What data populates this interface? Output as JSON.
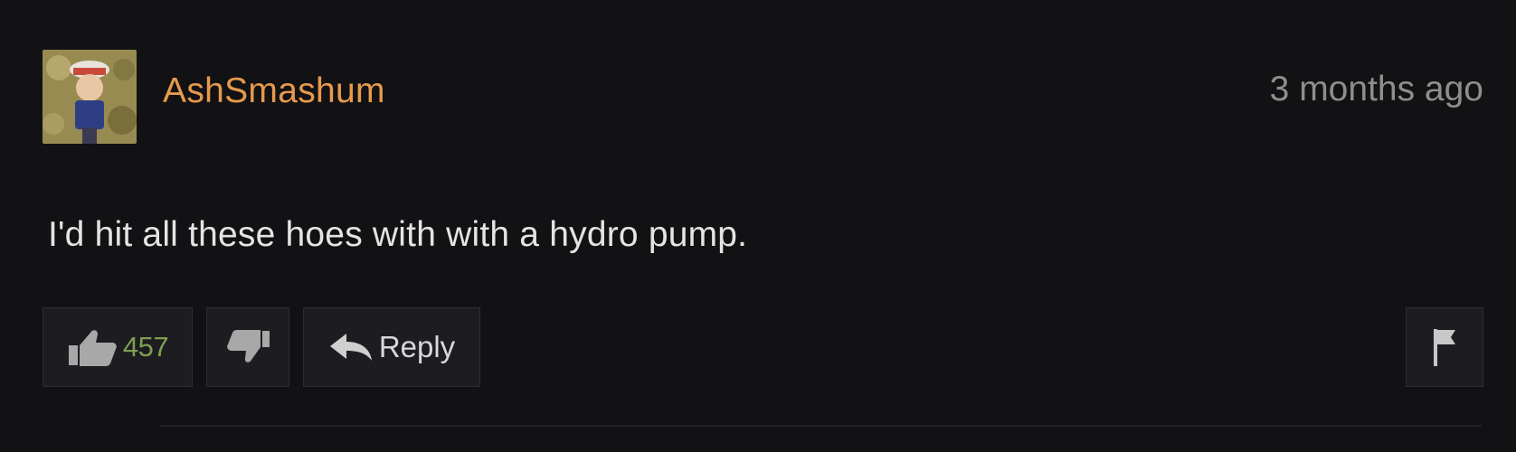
{
  "comment": {
    "username": "AshSmashum",
    "timestamp": "3 months ago",
    "text": "I'd hit all these hoes with with a hydro pump.",
    "avatar_icon": "user-avatar-icon",
    "actions": {
      "like_count": "457",
      "like_icon": "thumbs-up-icon",
      "dislike_icon": "thumbs-down-icon",
      "reply_label": "Reply",
      "reply_icon": "reply-arrow-icon",
      "flag_icon": "flag-icon"
    }
  },
  "colors": {
    "background": "#121114",
    "username": "#e69a4b",
    "timestamp": "#8e8e8e",
    "text": "#e4e4e4",
    "like_count": "#7d9e52",
    "button_bg": "#1d1c20"
  }
}
